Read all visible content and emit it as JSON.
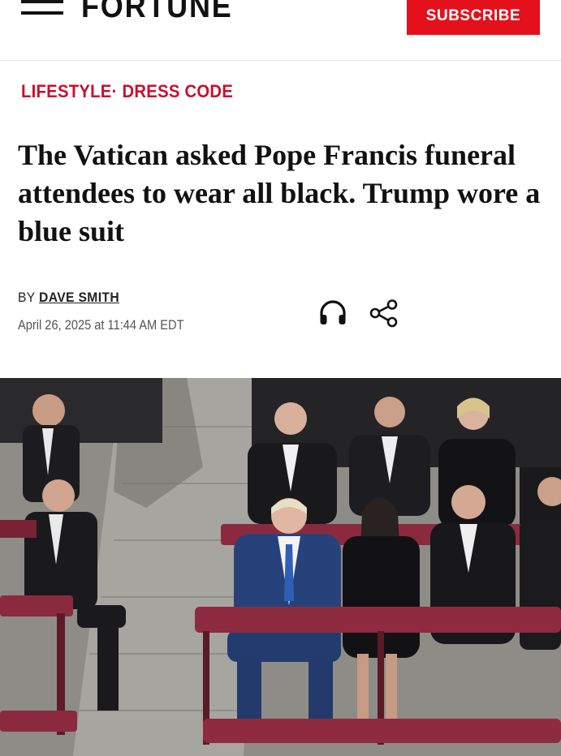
{
  "header": {
    "logo": "FORTUNE",
    "subscribe_label": "SUBSCRIBE",
    "menu_icon": "hamburger-menu-icon"
  },
  "breadcrumb": {
    "section": "LIFESTYLE",
    "separator": "·",
    "topic": "DRESS CODE"
  },
  "article": {
    "headline": "The Vatican asked Pope Francis funeral attendees to wear all black. Trump wore a blue suit",
    "byline_prefix": "BY",
    "author": "DAVE SMITH",
    "date": "April 26, 2025 at 11:44 AM EDT"
  },
  "actions": {
    "listen_icon": "headphones-icon",
    "share_icon": "share-icon"
  },
  "colors": {
    "brand_red": "#e4111d",
    "section_red": "#c8102e",
    "text": "#111111"
  }
}
